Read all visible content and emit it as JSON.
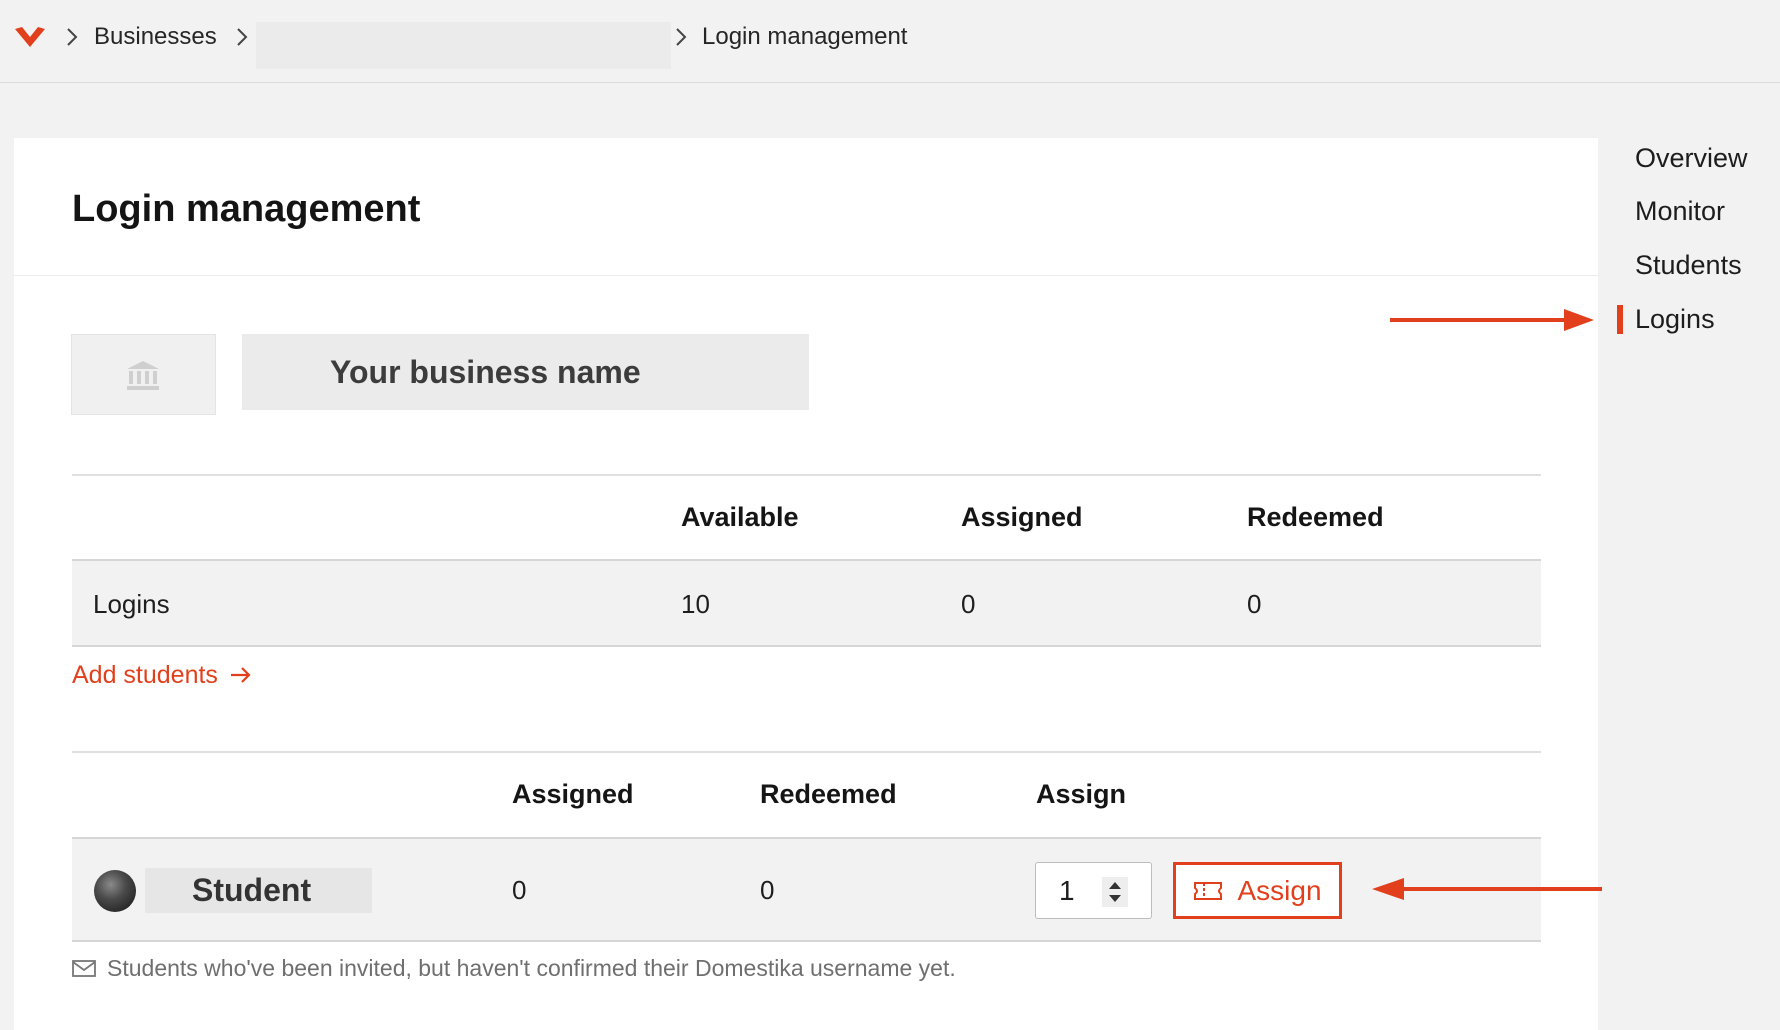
{
  "breadcrumb": {
    "items": [
      "Businesses",
      "",
      "Login management"
    ]
  },
  "page": {
    "title": "Login management"
  },
  "business": {
    "name": "Your business name",
    "logo_icon": "bank-icon"
  },
  "logins_table": {
    "headers": [
      "",
      "Available",
      "Assigned",
      "Redeemed"
    ],
    "row": {
      "label": "Logins",
      "available": "10",
      "assigned": "0",
      "redeemed": "0"
    }
  },
  "add_students": {
    "label": "Add students",
    "icon": "arrow-right-icon"
  },
  "students_table": {
    "headers": [
      "",
      "Assigned",
      "Redeemed",
      "Assign"
    ],
    "row": {
      "name": "Student",
      "assigned": "0",
      "redeemed": "0",
      "quantity": "1",
      "assign_label": "Assign"
    }
  },
  "footnote": "Students who've been invited, but haven't confirmed their Domestika username yet.",
  "sidenav": {
    "items": [
      "Overview",
      "Monitor",
      "Students",
      "Logins"
    ],
    "active": "Logins"
  },
  "colors": {
    "accent": "#e2401d",
    "background": "#f2f2f2",
    "card": "#ffffff"
  }
}
